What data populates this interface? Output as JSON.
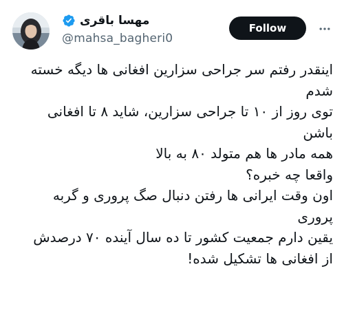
{
  "author": {
    "display_name": "مهسا باقری",
    "handle": "@mahsa_bagheri0",
    "verified": true,
    "verified_color": "#1d9bf0"
  },
  "actions": {
    "follow_label": "Follow",
    "more_icon": "more-horizontal-icon"
  },
  "colors": {
    "text": "#0f1419",
    "secondary_text": "#536471",
    "follow_bg": "#0f1419",
    "follow_text": "#ffffff"
  },
  "tweet": {
    "lines": [
      "اینقدر رفتم سر جراحی سزارین افغانی ها دیگه خسته",
      "شدم",
      "توی روز از ۱۰ تا جراحی سزارین، شاید ۸ تا افغانی",
      "باشن",
      "همه مادر ها هم متولد ۸۰ به بالا",
      "واقعا چه خبره؟",
      "اون وقت ایرانی ها رفتن دنبال صگ پروری و گربه",
      "پروری",
      "یقین دارم جمعیت کشور تا ده سال آینده ۷۰ درصدش",
      "از افغانی ها تشکیل شده!"
    ]
  }
}
